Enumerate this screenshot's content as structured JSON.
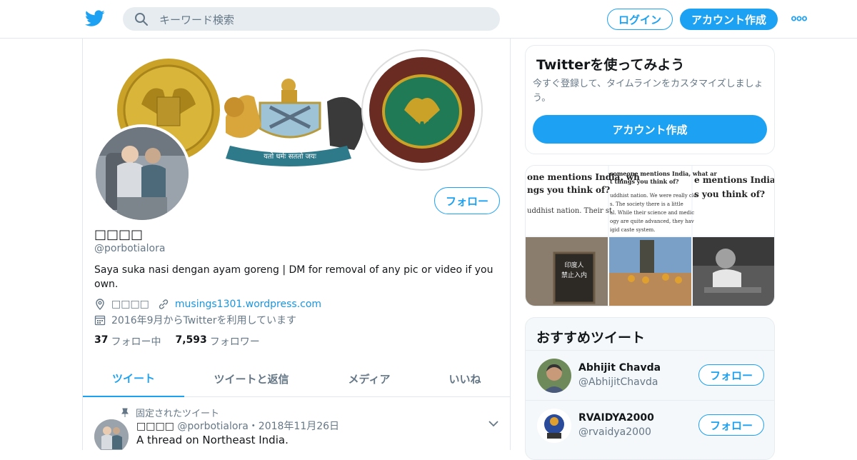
{
  "colors": {
    "accent": "#1da1f2",
    "link": "#1b95e0",
    "secondary_text": "#657786",
    "border": "#e1e8ed"
  },
  "nav": {
    "logo_icon": "twitter-bird-icon",
    "search_placeholder": "キーワード検索",
    "login_label": "ログイン",
    "signup_label": "アカウント作成",
    "more_icon": "more-dots-icon"
  },
  "profile": {
    "display_name": "□□□□",
    "handle": "@porbotialora",
    "bio": "Saya suka nasi dengan ayam goreng | DM for removal of any pic or video if you own.",
    "location": "□□□□",
    "website": "musings1301.wordpress.com",
    "joined": "2016年9月からTwitterを利用しています",
    "follow_label": "フォロー",
    "following_count": "37",
    "following_label": "フォロー中",
    "followers_count": "7,593",
    "followers_label": "フォロワー",
    "banner_motto": "यतो धर्मः सततो जयः"
  },
  "tabs": [
    {
      "label": "ツイート",
      "active": true
    },
    {
      "label": "ツイートと返信",
      "active": false
    },
    {
      "label": "メディア",
      "active": false
    },
    {
      "label": "いいね",
      "active": false
    }
  ],
  "pinned_tweet": {
    "pinned_label": "固定されたツイート",
    "author": "□□□□",
    "handle_date": "@porbotialora・2018年11月26日",
    "text": "A thread on Northeast India."
  },
  "promo": {
    "title": "Twitterを使ってみよう",
    "text": "今すぐ登録して、タイムラインをカスタマイズしましょう。",
    "button": "アカウント作成"
  },
  "media_grid": {
    "snippets": [
      "one mentions India, wh",
      "ngs you think of?",
      "uddhist nation. Their st",
      "someone mentions India, what ar",
      "t things you think of?",
      "uddhist nation. We were really clo",
      "s. The society there is a little",
      "al. While their science and medic",
      "ogy are quite advanced, they hav",
      "igid caste system.",
      "e mentions India, v",
      "s you think of?"
    ],
    "sign_text": [
      "印度人",
      "禁止入内"
    ]
  },
  "recommended": {
    "title": "おすすめツイート",
    "accounts": [
      {
        "name": "Abhijit Chavda",
        "handle": "@AbhijitChavda",
        "button": "フォロー"
      },
      {
        "name": "RVAIDYA2000",
        "handle": "@rvaidya2000",
        "button": "フォロー"
      }
    ]
  }
}
